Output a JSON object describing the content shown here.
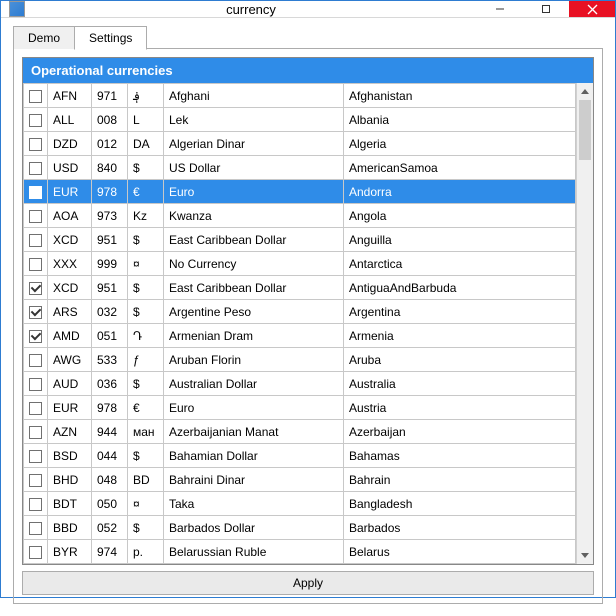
{
  "window": {
    "title": "currency"
  },
  "tabs": {
    "demo": "Demo",
    "settings": "Settings",
    "active": "settings"
  },
  "grid": {
    "title": "Operational currencies"
  },
  "rows": [
    {
      "checked": false,
      "selected": false,
      "code": "AFN",
      "num": "971",
      "sym": "؋",
      "name": "Afghani",
      "country": "Afghanistan"
    },
    {
      "checked": false,
      "selected": false,
      "code": "ALL",
      "num": "008",
      "sym": "L",
      "name": "Lek",
      "country": "Albania"
    },
    {
      "checked": false,
      "selected": false,
      "code": "DZD",
      "num": "012",
      "sym": "DA",
      "name": "Algerian Dinar",
      "country": "Algeria"
    },
    {
      "checked": false,
      "selected": false,
      "code": "USD",
      "num": "840",
      "sym": "$",
      "name": "US Dollar",
      "country": "AmericanSamoa"
    },
    {
      "checked": false,
      "selected": true,
      "code": "EUR",
      "num": "978",
      "sym": "€",
      "name": "Euro",
      "country": "Andorra"
    },
    {
      "checked": false,
      "selected": false,
      "code": "AOA",
      "num": "973",
      "sym": "Kz",
      "name": "Kwanza",
      "country": "Angola"
    },
    {
      "checked": false,
      "selected": false,
      "code": "XCD",
      "num": "951",
      "sym": "$",
      "name": "East Caribbean Dollar",
      "country": "Anguilla"
    },
    {
      "checked": false,
      "selected": false,
      "code": "XXX",
      "num": "999",
      "sym": "¤",
      "name": "No Currency",
      "country": "Antarctica"
    },
    {
      "checked": true,
      "selected": false,
      "code": "XCD",
      "num": "951",
      "sym": "$",
      "name": "East Caribbean Dollar",
      "country": "AntiguaAndBarbuda"
    },
    {
      "checked": true,
      "selected": false,
      "code": "ARS",
      "num": "032",
      "sym": "$",
      "name": "Argentine Peso",
      "country": "Argentina"
    },
    {
      "checked": true,
      "selected": false,
      "code": "AMD",
      "num": "051",
      "sym": "Դ",
      "name": "Armenian Dram",
      "country": "Armenia"
    },
    {
      "checked": false,
      "selected": false,
      "code": "AWG",
      "num": "533",
      "sym": "ƒ",
      "name": "Aruban Florin",
      "country": "Aruba"
    },
    {
      "checked": false,
      "selected": false,
      "code": "AUD",
      "num": "036",
      "sym": "$",
      "name": "Australian Dollar",
      "country": "Australia"
    },
    {
      "checked": false,
      "selected": false,
      "code": "EUR",
      "num": "978",
      "sym": "€",
      "name": "Euro",
      "country": "Austria"
    },
    {
      "checked": false,
      "selected": false,
      "code": "AZN",
      "num": "944",
      "sym": "ман",
      "name": "Azerbaijanian Manat",
      "country": "Azerbaijan"
    },
    {
      "checked": false,
      "selected": false,
      "code": "BSD",
      "num": "044",
      "sym": "$",
      "name": "Bahamian Dollar",
      "country": "Bahamas"
    },
    {
      "checked": false,
      "selected": false,
      "code": "BHD",
      "num": "048",
      "sym": "BD",
      "name": "Bahraini Dinar",
      "country": "Bahrain"
    },
    {
      "checked": false,
      "selected": false,
      "code": "BDT",
      "num": "050",
      "sym": "¤",
      "name": "Taka",
      "country": "Bangladesh"
    },
    {
      "checked": false,
      "selected": false,
      "code": "BBD",
      "num": "052",
      "sym": "$",
      "name": "Barbados Dollar",
      "country": "Barbados"
    },
    {
      "checked": false,
      "selected": false,
      "code": "BYR",
      "num": "974",
      "sym": "p.",
      "name": "Belarussian Ruble",
      "country": "Belarus"
    }
  ],
  "buttons": {
    "apply": "Apply"
  }
}
